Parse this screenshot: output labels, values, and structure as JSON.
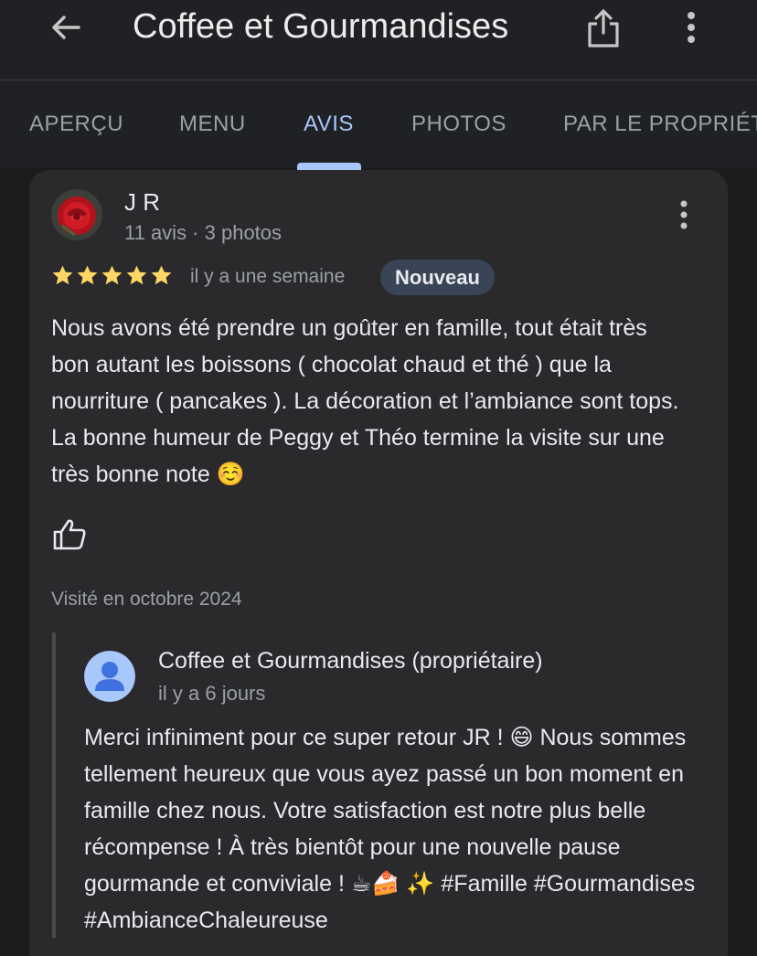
{
  "header": {
    "title": "Coffee et Gourmandises",
    "back_icon": "arrow-left-icon",
    "share_icon": "share-icon",
    "more_icon": "more-vertical-icon"
  },
  "tabs": [
    {
      "label": "APERÇU",
      "active": false
    },
    {
      "label": "MENU",
      "active": false
    },
    {
      "label": "AVIS",
      "active": true
    },
    {
      "label": "PHOTOS",
      "active": false
    },
    {
      "label": "PAR LE PROPRIÉTA",
      "active": false
    }
  ],
  "review": {
    "author": "J R",
    "author_meta": "11 avis · 3 photos",
    "rating": 5,
    "date": "il y a une semaine",
    "badge": "Nouveau",
    "text": "Nous avons été prendre un goûter en famille, tout était très bon autant les boissons ( chocolat chaud et thé ) que la nourriture ( pancakes ). La décoration et l’ambiance sont tops. La bonne humeur de Peggy et Théo termine la visite sur une très bonne note ☺️",
    "visited": "Visité en octobre 2024",
    "like_icon": "thumbs-up-icon"
  },
  "owner_reply": {
    "name": "Coffee et Gourmandises (propriétaire)",
    "date": "il y a 6 jours",
    "text": "Merci infiniment pour ce super retour JR ! 😄 Nous sommes tellement heureux que vous ayez passé un bon moment en famille chez nous. Votre satisfaction est notre plus belle récompense ! À très bientôt pour une nouvelle pause gourmande et conviviale ! ☕🍰 ✨ #Famille #Gourmandises #AmbianceChaleureuse"
  },
  "colors": {
    "background": "#1c1c1e",
    "card": "#2a2a2d",
    "accent": "#a8c7fa",
    "star": "#fdd663",
    "badge": "#394457"
  }
}
